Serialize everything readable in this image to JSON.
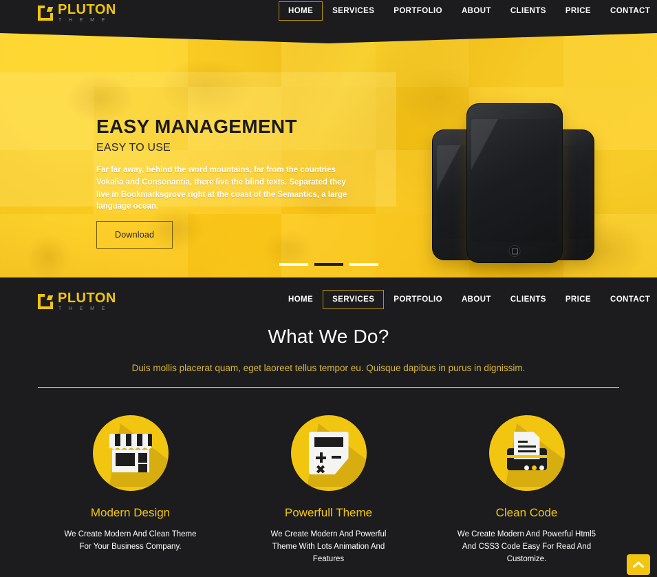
{
  "brand": {
    "name": "PLUTON",
    "tagline": "T H E M E",
    "icon": "bracket-logo-icon"
  },
  "colors": {
    "accent": "#f2c511",
    "dark": "#1c1c1e",
    "hero": "#f0c419",
    "card_title": "#f2c511"
  },
  "top_nav": {
    "items": [
      {
        "label": "HOME",
        "active": true
      },
      {
        "label": "SERVICES",
        "active": false
      },
      {
        "label": "PORTFOLIO",
        "active": false
      },
      {
        "label": "ABOUT",
        "active": false
      },
      {
        "label": "CLIENTS",
        "active": false
      },
      {
        "label": "PRICE",
        "active": false
      },
      {
        "label": "CONTACT",
        "active": false
      }
    ]
  },
  "hero": {
    "title": "EASY MANAGEMENT",
    "subtitle": "EASY TO USE",
    "description": "Far far away, behind the word mountains, far from the countries Vokalia and Consonantia, there live the blind texts. Separated they live in Bookmarksgrove right at the coast of the Semantics, a large language ocean.",
    "button_label": "Download",
    "slides": [
      {
        "active": false
      },
      {
        "active": true
      },
      {
        "active": false
      }
    ],
    "devices": [
      "phone-left",
      "phone-center",
      "phone-right"
    ]
  },
  "sub_nav": {
    "items": [
      {
        "label": "HOME",
        "active": false
      },
      {
        "label": "SERVICES",
        "active": true
      },
      {
        "label": "PORTFOLIO",
        "active": false
      },
      {
        "label": "ABOUT",
        "active": false
      },
      {
        "label": "CLIENTS",
        "active": false
      },
      {
        "label": "PRICE",
        "active": false
      },
      {
        "label": "CONTACT",
        "active": false
      }
    ]
  },
  "services": {
    "heading": "What We Do?",
    "subheading": "Duis mollis placerat quam, eget laoreet tellus tempor eu. Quisque dapibus in purus in dignissim.",
    "cards": [
      {
        "icon": "shop-icon",
        "title": "Modern Design",
        "description": "We Create Modern And Clean Theme For Your Business Company."
      },
      {
        "icon": "calculator-icon",
        "title": "Powerfull Theme",
        "description": "We Create Modern And Powerful Theme With Lots Animation And Features"
      },
      {
        "icon": "printer-icon",
        "title": "Clean Code",
        "description": "We Create Modern And Powerful Html5 And CSS3 Code Easy For Read And Customize."
      }
    ]
  },
  "to_top": {
    "icon": "chevron-up-icon",
    "label": ""
  }
}
